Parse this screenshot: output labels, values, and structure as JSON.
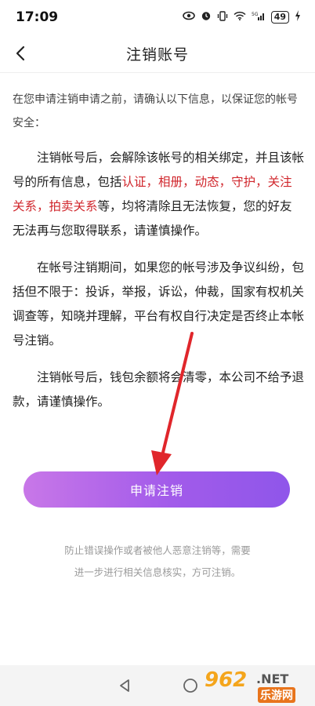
{
  "status_bar": {
    "time": "17:09",
    "battery": "49"
  },
  "header": {
    "title": "注销账号"
  },
  "content": {
    "intro": "在您申请注销申请之前，请确认以下信息，以保证您的帐号安全：",
    "para1": {
      "prefix": "注销帐号后，会解除该帐号的相关绑定，并且该帐号的所有信息，包括",
      "highlights": [
        "认证",
        "相册",
        "动态",
        "守护",
        "关注关系",
        "拍卖关系"
      ],
      "separator": "，",
      "suffix": "等，均将清除且无法恢复，您的好友无法再与您取得联系，请谨慎操作。"
    },
    "para2": "在帐号注销期间，如果您的帐号涉及争议纠纷，包括但不限于：投诉，举报，诉讼，仲裁，国家有权机关调查等，知晓并理解，平台有权自行决定是否终止本帐号注销。",
    "para3": "注销帐号后，钱包余额将会清零，本公司不给予退款，请谨慎操作。"
  },
  "apply_button": {
    "label": "申请注销"
  },
  "footnote": {
    "line1": "防止错误操作或者被他人恶意注销等，需要",
    "line2": "进一步进行相关信息核实，方可注销。"
  },
  "watermark": {
    "number": "962",
    "suffix": ".NET",
    "name": "乐游网"
  },
  "colors": {
    "highlight": "#d0252b",
    "button_gradient_start": "#c877e8",
    "button_gradient_end": "#8f56ea",
    "arrow": "#e0262b"
  },
  "icons": {
    "back": "chevron-left-icon",
    "nav_back": "triangle-back-icon",
    "nav_home": "circle-home-icon"
  }
}
